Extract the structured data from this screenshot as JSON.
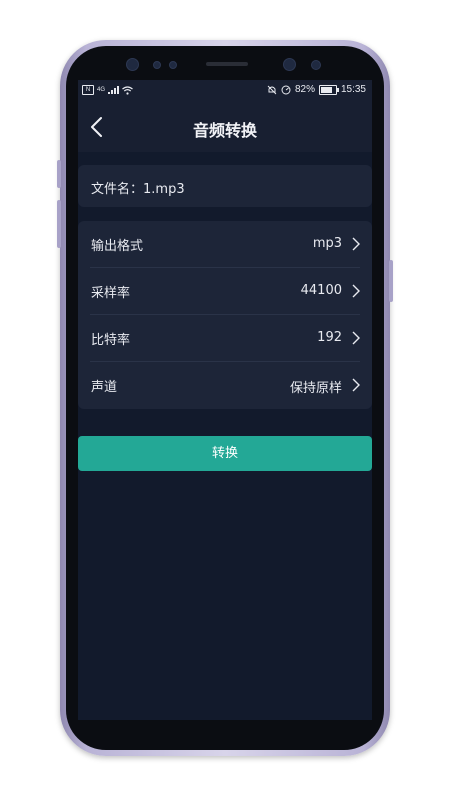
{
  "status_bar": {
    "nfc": "N",
    "network": "4G",
    "battery_percent": "82%",
    "time": "15:35",
    "battery_level": 0.82
  },
  "header": {
    "title": "音频转换",
    "back_icon": "chevron-left-icon"
  },
  "file": {
    "label": "文件名：1.mp3"
  },
  "settings": [
    {
      "label": "输出格式",
      "value": "mp3"
    },
    {
      "label": "采样率",
      "value": "44100"
    },
    {
      "label": "比特率",
      "value": "192"
    },
    {
      "label": "声道",
      "value": "保持原样"
    }
  ],
  "convert_button": {
    "label": "转换"
  },
  "colors": {
    "background": "#121a2c",
    "card": "#1d2538",
    "accent": "#23a896",
    "text": "#e8eaf0"
  }
}
